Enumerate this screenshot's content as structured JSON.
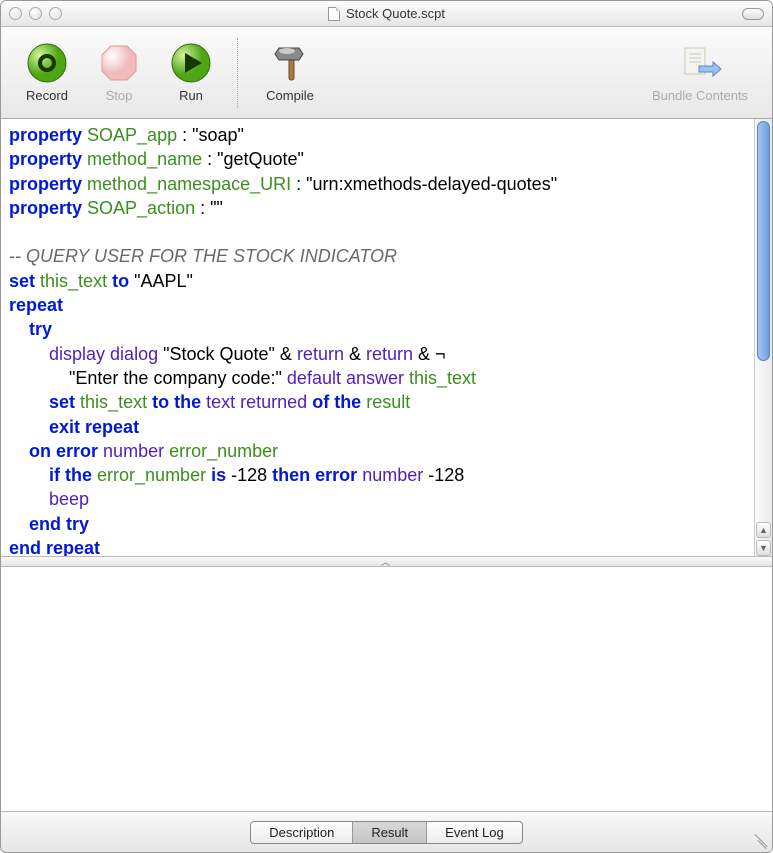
{
  "window": {
    "title": "Stock Quote.scpt"
  },
  "toolbar": {
    "record": "Record",
    "stop": "Stop",
    "run": "Run",
    "compile": "Compile",
    "bundle": "Bundle Contents"
  },
  "code": {
    "lines": [
      {
        "t": [
          [
            "k",
            "property"
          ],
          [
            "s",
            " "
          ],
          [
            "v",
            "SOAP_app"
          ],
          [
            "s",
            " : \"soap\""
          ]
        ]
      },
      {
        "t": [
          [
            "k",
            "property"
          ],
          [
            "s",
            " "
          ],
          [
            "v",
            "method_name"
          ],
          [
            "s",
            " : \"getQuote\""
          ]
        ]
      },
      {
        "t": [
          [
            "k",
            "property"
          ],
          [
            "s",
            " "
          ],
          [
            "v",
            "method_namespace_URI"
          ],
          [
            "s",
            " : \"urn:xmethods-delayed-quotes\""
          ]
        ]
      },
      {
        "t": [
          [
            "k",
            "property"
          ],
          [
            "s",
            " "
          ],
          [
            "v",
            "SOAP_action"
          ],
          [
            "s",
            " : \"\""
          ]
        ]
      },
      {
        "t": []
      },
      {
        "t": [
          [
            "c",
            "-- QUERY USER FOR THE STOCK INDICATOR"
          ]
        ]
      },
      {
        "t": [
          [
            "k",
            "set"
          ],
          [
            "s",
            " "
          ],
          [
            "v",
            "this_text"
          ],
          [
            "s",
            " "
          ],
          [
            "k",
            "to"
          ],
          [
            "s",
            " \"AAPL\""
          ]
        ]
      },
      {
        "t": [
          [
            "k",
            "repeat"
          ]
        ]
      },
      {
        "t": [
          [
            "s",
            "    "
          ],
          [
            "k",
            "try"
          ]
        ]
      },
      {
        "t": [
          [
            "s",
            "        "
          ],
          [
            "p",
            "display dialog"
          ],
          [
            "s",
            " \"Stock Quote\" & "
          ],
          [
            "p",
            "return"
          ],
          [
            "s",
            " & "
          ],
          [
            "p",
            "return"
          ],
          [
            "s",
            " & ¬"
          ]
        ]
      },
      {
        "t": [
          [
            "s",
            "            \"Enter the company code:\" "
          ],
          [
            "p",
            "default answer"
          ],
          [
            "s",
            " "
          ],
          [
            "v",
            "this_text"
          ]
        ]
      },
      {
        "t": [
          [
            "s",
            "        "
          ],
          [
            "k",
            "set"
          ],
          [
            "s",
            " "
          ],
          [
            "v",
            "this_text"
          ],
          [
            "s",
            " "
          ],
          [
            "k",
            "to the"
          ],
          [
            "s",
            " "
          ],
          [
            "p",
            "text returned"
          ],
          [
            "s",
            " "
          ],
          [
            "k",
            "of the"
          ],
          [
            "s",
            " "
          ],
          [
            "v",
            "result"
          ]
        ]
      },
      {
        "t": [
          [
            "s",
            "        "
          ],
          [
            "k",
            "exit repeat"
          ]
        ]
      },
      {
        "t": [
          [
            "s",
            "    "
          ],
          [
            "k",
            "on error"
          ],
          [
            "s",
            " "
          ],
          [
            "p",
            "number"
          ],
          [
            "s",
            " "
          ],
          [
            "v",
            "error_number"
          ]
        ]
      },
      {
        "t": [
          [
            "s",
            "        "
          ],
          [
            "k",
            "if the"
          ],
          [
            "s",
            " "
          ],
          [
            "v",
            "error_number"
          ],
          [
            "s",
            " "
          ],
          [
            "k",
            "is"
          ],
          [
            "s",
            " -128 "
          ],
          [
            "k",
            "then"
          ],
          [
            "s",
            " "
          ],
          [
            "k",
            "error"
          ],
          [
            "s",
            " "
          ],
          [
            "p",
            "number"
          ],
          [
            "s",
            " -128"
          ]
        ]
      },
      {
        "t": [
          [
            "s",
            "        "
          ],
          [
            "p",
            "beep"
          ]
        ]
      },
      {
        "t": [
          [
            "s",
            "    "
          ],
          [
            "k",
            "end try"
          ]
        ]
      },
      {
        "t": [
          [
            "k",
            "end repeat"
          ]
        ]
      }
    ]
  },
  "tabs": {
    "description": "Description",
    "result": "Result",
    "eventlog": "Event Log",
    "selected": "result"
  }
}
